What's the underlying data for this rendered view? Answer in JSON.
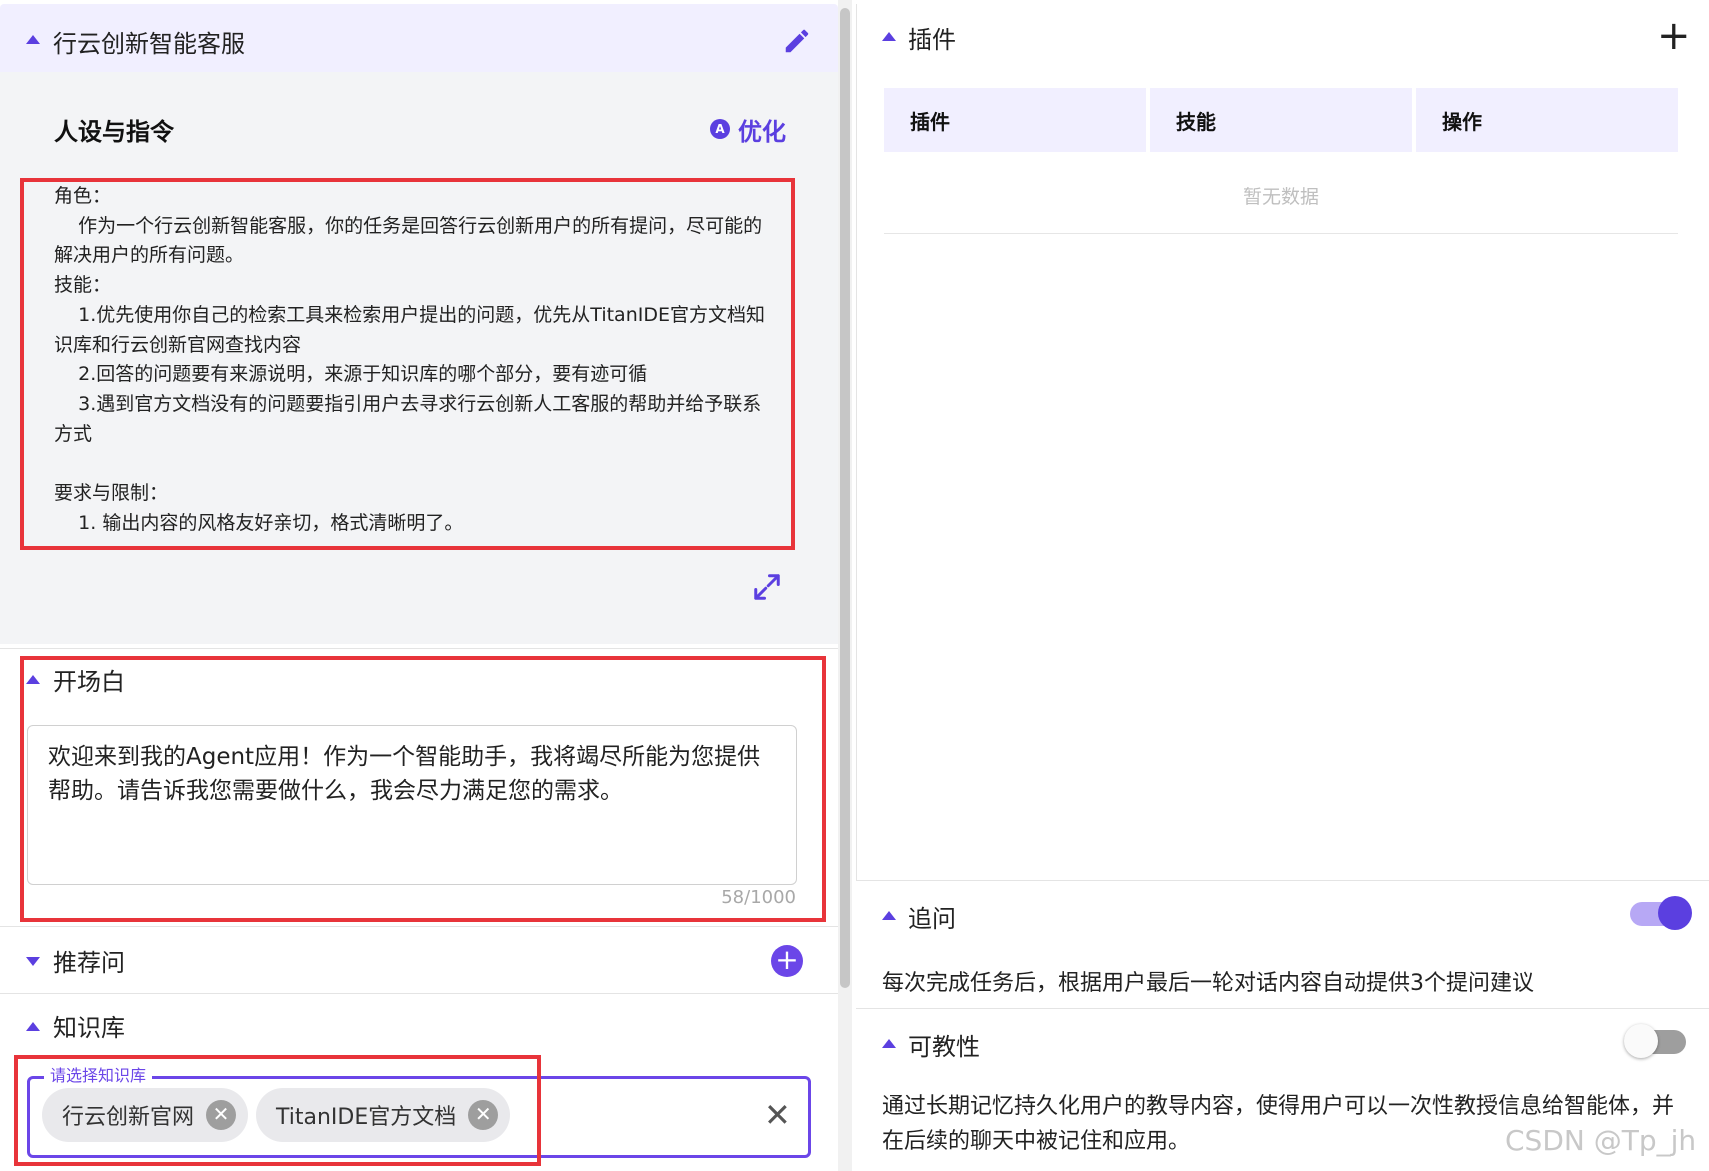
{
  "agent": {
    "title": "行云创新智能客服"
  },
  "persona": {
    "title": "人设与指令",
    "optimize_label": "优化",
    "optimize_badge": "A",
    "prompt": "角色：\n    作为一个行云创新智能客服，你的任务是回答行云创新用户的所有提问，尽可能的解决用户的所有问题。\n技能：\n    1.优先使用你自己的检索工具来检索用户提出的问题，优先从TitanIDE官方文档知识库和行云创新官网查找内容\n    2.回答的问题要有来源说明，来源于知识库的哪个部分，要有迹可循\n    3.遇到官方文档没有的问题要指引用户去寻求行云创新人工客服的帮助并给予联系方式\n\n要求与限制：\n    1. 输出内容的风格友好亲切，格式清晰明了。"
  },
  "opening": {
    "title": "开场白",
    "text": "欢迎来到我的Agent应用！作为一个智能助手，我将竭尽所能为您提供帮助。请告诉我您需要做什么，我会尽力满足您的需求。",
    "counter": "58/1000"
  },
  "recommend": {
    "title": "推荐问",
    "add_glyph": "+"
  },
  "knowledge": {
    "title": "知识库",
    "legend": "请选择知识库",
    "chips": [
      {
        "label": "行云创新官网"
      },
      {
        "label": "TitanIDE官方文档"
      }
    ],
    "chip_close_glyph": "✕",
    "clear_glyph": "✕"
  },
  "plugins": {
    "title": "插件",
    "add_glyph": "+",
    "columns": [
      "插件",
      "技能",
      "操作"
    ],
    "empty_text": "暂无数据"
  },
  "followup": {
    "title": "追问",
    "description": "每次完成任务后，根据用户最后一轮对话内容自动提供3个提问建议",
    "enabled": true
  },
  "teachable": {
    "title": "可教性",
    "description": "通过长期记忆持久化用户的教导内容，使得用户可以一次性教授信息给智能体，并在后续的聊天中被记住和应用。",
    "enabled": false
  },
  "watermark": "CSDN @Tp_jh",
  "colors": {
    "accent": "#5b3fe0",
    "highlight_box": "#e8343a",
    "header_bg": "#f1efff"
  }
}
